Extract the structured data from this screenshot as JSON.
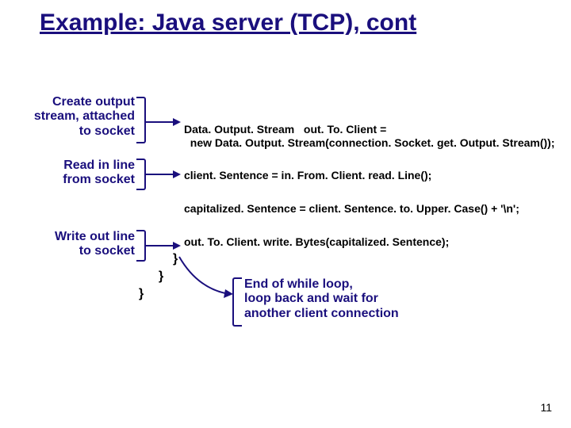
{
  "title": "Example: Java server (TCP), cont",
  "annot1": "Create output\nstream, attached\nto socket",
  "annot2": "Read in  line\nfrom socket",
  "annot3": "Write out line\nto socket",
  "code1": "Data. Output. Stream   out. To. Client =\n  new Data. Output. Stream(connection. Socket. get. Output. Stream());",
  "code2": "client. Sentence = in. From. Client. read. Line();",
  "code3": "capitalized. Sentence = client. Sentence. to. Upper. Case() + '\\n';",
  "code4": "out. To. Client. write. Bytes(capitalized. Sentence);",
  "brace1": "}",
  "brace2": "}",
  "brace3": "}",
  "callout": "End of while loop,\nloop back and wait for\nanother client connection",
  "pagenum": "11"
}
